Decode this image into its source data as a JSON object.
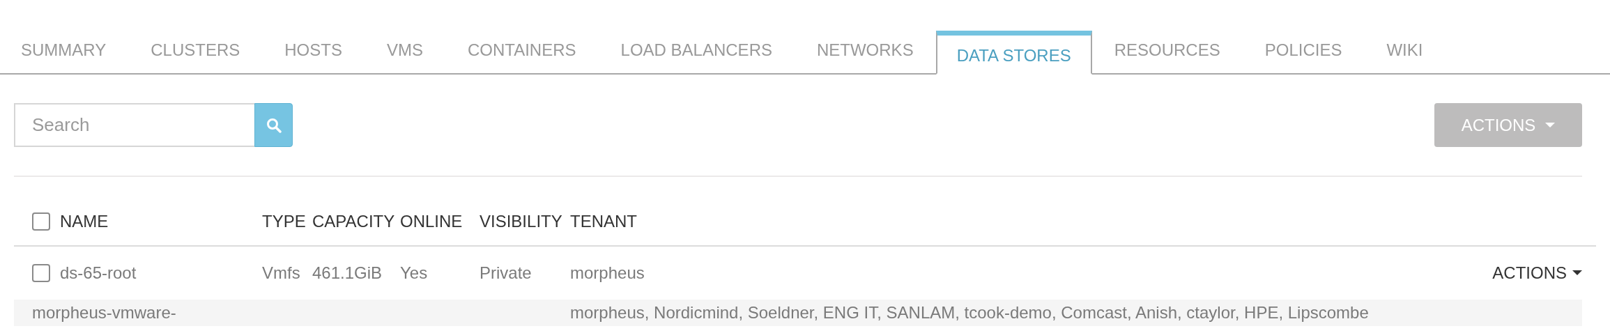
{
  "tabs": [
    {
      "label": "SUMMARY",
      "selected": false
    },
    {
      "label": "CLUSTERS",
      "selected": false
    },
    {
      "label": "HOSTS",
      "selected": false
    },
    {
      "label": "VMS",
      "selected": false
    },
    {
      "label": "CONTAINERS",
      "selected": false
    },
    {
      "label": "LOAD BALANCERS",
      "selected": false
    },
    {
      "label": "NETWORKS",
      "selected": false
    },
    {
      "label": "DATA STORES",
      "selected": true
    },
    {
      "label": "RESOURCES",
      "selected": false
    },
    {
      "label": "POLICIES",
      "selected": false
    },
    {
      "label": "WIKI",
      "selected": false
    }
  ],
  "search": {
    "placeholder": "Search"
  },
  "actions_button": {
    "label": "ACTIONS",
    "disabled": true
  },
  "table": {
    "select_all": {
      "checked": false
    },
    "columns": [
      "NAME",
      "TYPE",
      "CAPACITY",
      "ONLINE",
      "VISIBILITY",
      "TENANT"
    ],
    "rows": [
      {
        "checked": false,
        "cells": [
          "ds-65-root",
          "Vmfs",
          "461.1GiB",
          "Yes",
          "Private",
          "morpheus"
        ],
        "action": "ACTIONS"
      },
      {
        "cells": [
          "morpheus-vmware-",
          "",
          "",
          "",
          "",
          "morpheus, Nordicmind, Soeldner, ENG IT, SANLAM, tcook-demo, Comcast, Anish, ctaylor, HPE, Lipscombe"
        ],
        "shaded": true
      }
    ]
  }
}
